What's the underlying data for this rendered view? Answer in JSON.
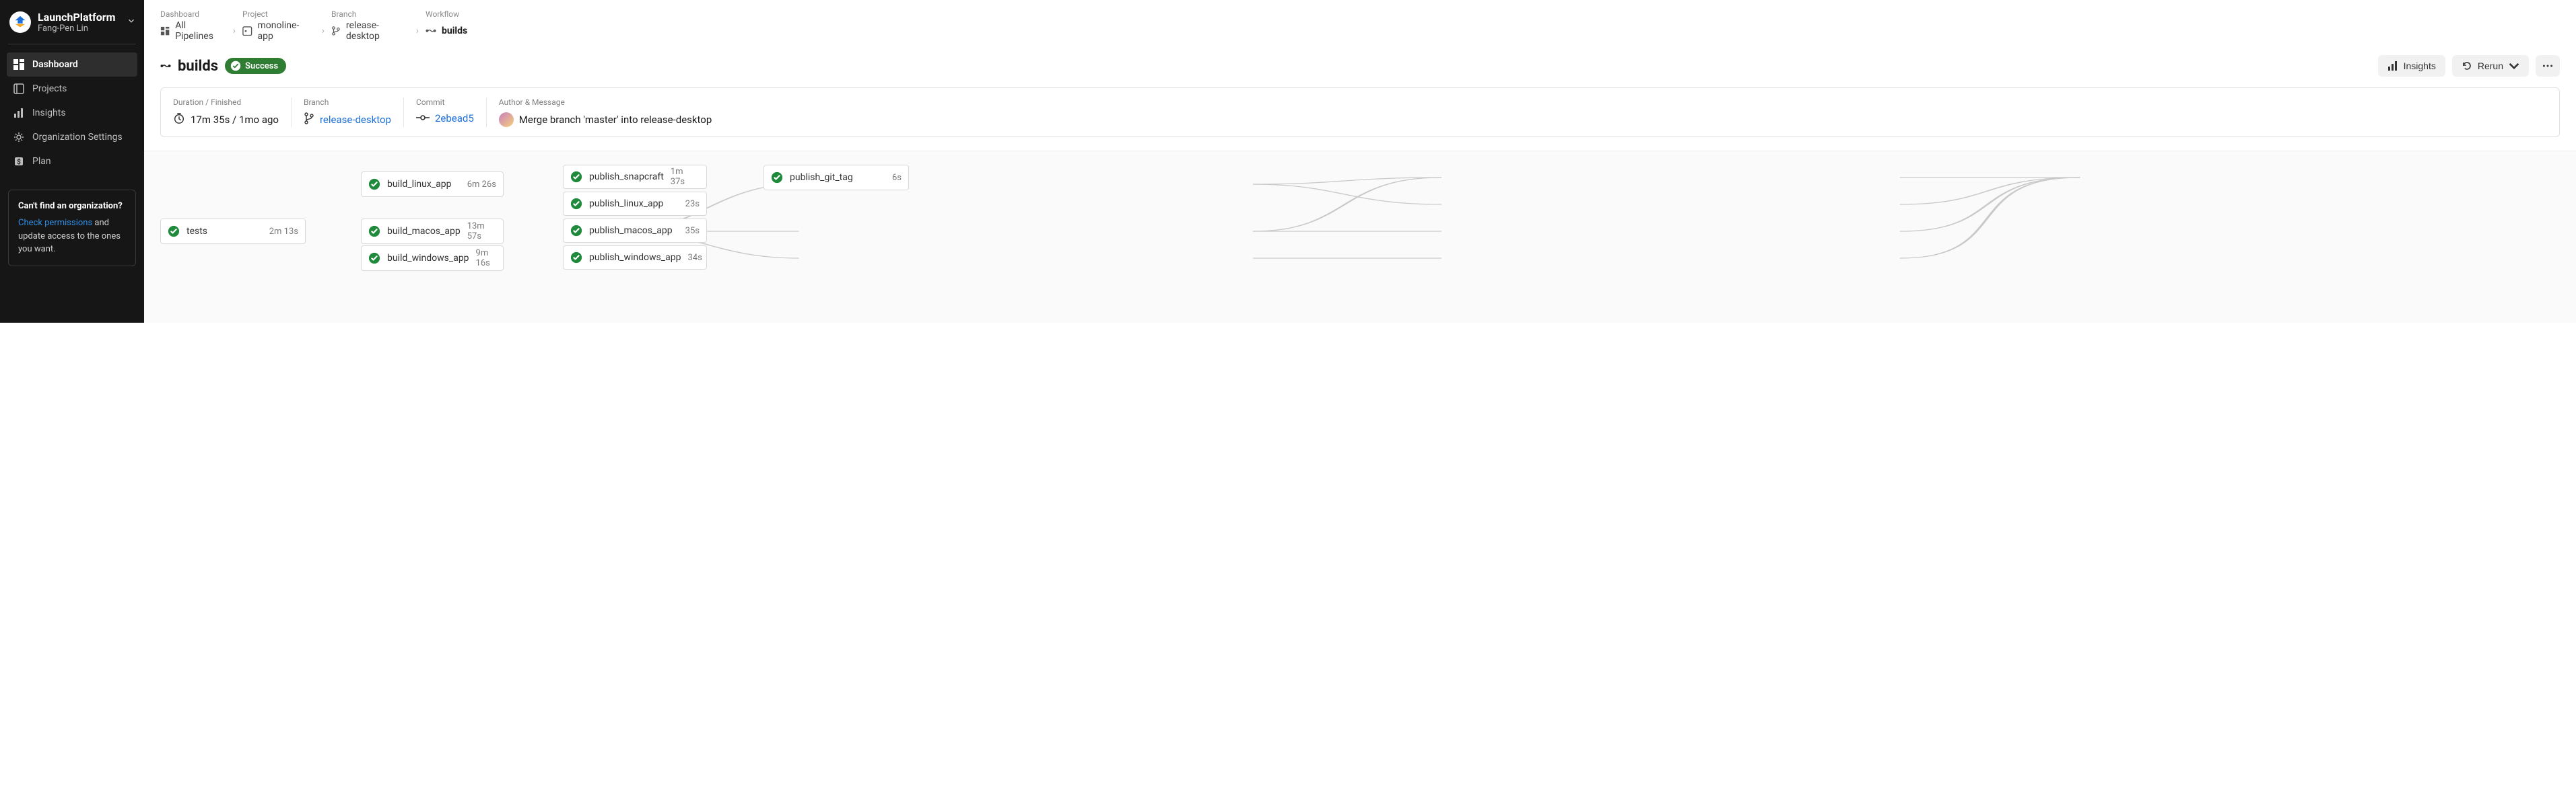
{
  "sidebar": {
    "org_name": "LaunchPlatform",
    "org_subtitle": "Fang-Pen Lin",
    "nav": [
      {
        "label": "Dashboard"
      },
      {
        "label": "Projects"
      },
      {
        "label": "Insights"
      },
      {
        "label": "Organization Settings"
      },
      {
        "label": "Plan"
      }
    ],
    "help": {
      "title": "Can't find an organization?",
      "link_text": "Check permissions",
      "rest": " and update access to the ones you want."
    }
  },
  "breadcrumbs": {
    "labels": [
      "Dashboard",
      "Project",
      "Branch",
      "Workflow"
    ],
    "items": [
      {
        "text": "All Pipelines"
      },
      {
        "text": "monoline-app"
      },
      {
        "text": "release-desktop"
      },
      {
        "text": "builds"
      }
    ]
  },
  "workflow": {
    "name": "builds",
    "status_label": "Success"
  },
  "actions": {
    "insights": "Insights",
    "rerun": "Rerun"
  },
  "summary": {
    "duration_label": "Duration / Finished",
    "duration_value": "17m 35s / 1mo ago",
    "branch_label": "Branch",
    "branch_value": "release-desktop",
    "commit_label": "Commit",
    "commit_value": "2ebead5",
    "author_label": "Author & Message",
    "author_message": "Merge branch 'master' into release-desktop"
  },
  "graph": {
    "jobs": [
      {
        "id": "tests",
        "name": "tests",
        "dur": "2m 13s",
        "col": 0,
        "row": 1
      },
      {
        "id": "build_linux_app",
        "name": "build_linux_app",
        "dur": "6m 26s",
        "col": 1,
        "row": 0
      },
      {
        "id": "build_macos_app",
        "name": "build_macos_app",
        "dur": "13m 57s",
        "col": 1,
        "row": 1
      },
      {
        "id": "build_windows_app",
        "name": "build_windows_app",
        "dur": "9m 16s",
        "col": 1,
        "row": 2
      },
      {
        "id": "publish_snapcraft",
        "name": "publish_snapcraft",
        "dur": "1m 37s",
        "col": 2,
        "row": -1
      },
      {
        "id": "publish_linux_app",
        "name": "publish_linux_app",
        "dur": "23s",
        "col": 2,
        "row": 0
      },
      {
        "id": "publish_macos_app",
        "name": "publish_macos_app",
        "dur": "35s",
        "col": 2,
        "row": 1
      },
      {
        "id": "publish_windows_app",
        "name": "publish_windows_app",
        "dur": "34s",
        "col": 2,
        "row": 2
      },
      {
        "id": "publish_git_tag",
        "name": "publish_git_tag",
        "dur": "6s",
        "col": 3,
        "row": -1
      }
    ]
  }
}
